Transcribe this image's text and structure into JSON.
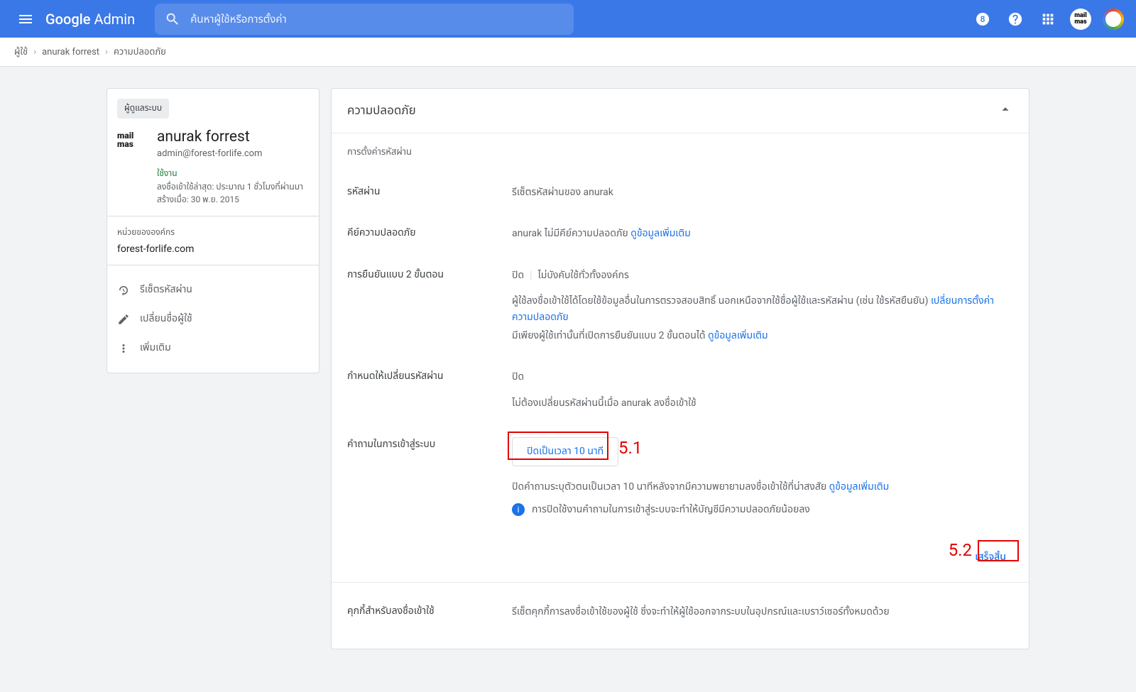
{
  "header": {
    "logo_google": "Google",
    "logo_admin": "Admin",
    "search_placeholder": "ค้นหาผู้ใช้หรือการตั้งค่า",
    "badge": "8",
    "mailmas": "mail\nmas"
  },
  "breadcrumb": {
    "users": "ผู้ใช้",
    "name": "anurak forrest",
    "current": "ความปลอดภัย"
  },
  "sidebar": {
    "admin_chip": "ผู้ดูแลระบบ",
    "userlogo": "mail\nmas",
    "name": "anurak forrest",
    "email": "admin@forest-forlife.com",
    "status": "ใช้งาน",
    "last_login": "ลงชื่อเข้าใช้ล่าสุด: ประมาณ 1 ชั่วโมงที่ผ่านมา",
    "created": "สร้างเมื่อ: 30 พ.ย. 2015",
    "org_label": "หน่วยขององค์กร",
    "org_domain": "forest-forlife.com",
    "actions": {
      "reset_password": "รีเซ็ตรหัสผ่าน",
      "rename": "เปลี่ยนชื่อผู้ใช้",
      "more": "เพิ่มเติม"
    }
  },
  "content": {
    "title": "ความปลอดภัย",
    "password_settings": "การตั้งค่ารหัสผ่าน",
    "password_label": "รหัสผ่าน",
    "password_value": "รีเซ็ตรหัสผ่านของ anurak",
    "seckey_label": "คีย์ความปลอดภัย",
    "seckey_value": "anurak ไม่มีคีย์ความปลอดภัย ",
    "seckey_link": "ดูข้อมูลเพิ่มเติม",
    "twostep_label": "การยืนยันแบบ 2 ขั้นตอน",
    "twostep_status": "ปิด",
    "twostep_org": "ไม่บังคับใช้ทั่วทั้งองค์กร",
    "twostep_desc": "ผู้ใช้ลงชื่อเข้าใช้ได้โดยใช้ข้อมูลอื่นในการตรวจสอบสิทธิ์ นอกเหนือจากใช้ชื่อผู้ใช้และรหัสผ่าน (เช่น ใช้รหัสยืนยัน) ",
    "twostep_link1": "เปลี่ยนการตั้งค่าความปลอดภัย",
    "twostep_desc2": "มีเพียงผู้ใช้เท่านั้นที่เปิดการยืนยันแบบ 2 ขั้นตอนได้ ",
    "twostep_link2": "ดูข้อมูลเพิ่มเติม",
    "forcepw_label": "กำหนดให้เปลี่ยนรหัสผ่าน",
    "forcepw_status": "ปิด",
    "forcepw_desc": "ไม่ต้องเปลี่ยนรหัสผ่านนี้เมื่อ anurak ลงชื่อเข้าใช้",
    "challenge_label": "คำถามในการเข้าสู่ระบบ",
    "challenge_button": "ปิดเป็นเวลา 10 นาที",
    "challenge_desc": "ปิดคำถามระบุตัวตนเป็นเวลา 10 นาทีหลังจากมีความพยายามลงชื่อเข้าใช้ที่น่าสงสัย ",
    "challenge_link": "ดูข้อมูลเพิ่มเติม",
    "challenge_warning": "การปิดใช้งานคำถามในการเข้าสู่ระบบจะทำให้บัญชีมีความปลอดภัยน้อยลง",
    "done": "เสร็จสิ้น",
    "cookies_label": "คุกกี้สำหรับลงชื่อเข้าใช้",
    "cookies_desc": "รีเซ็ตคุกกี้การลงชื่อเข้าใช้ของผู้ใช้ ซึ่งจะทำให้ผู้ใช้ออกจากระบบในอุปกรณ์และเบราว์เซอร์ทั้งหมดด้วย"
  },
  "annotations": {
    "a1": "5.1",
    "a2": "5.2"
  }
}
